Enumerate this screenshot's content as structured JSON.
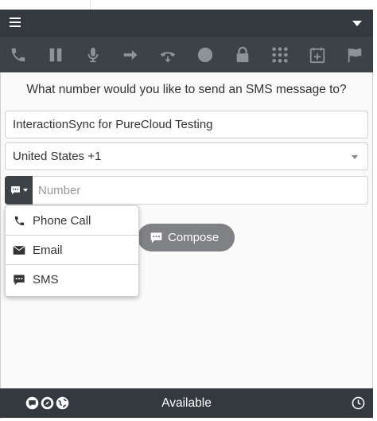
{
  "header": {
    "menu_icon": "hamburger-icon",
    "dropdown_icon": "caret-down-icon"
  },
  "toolbar": {
    "icons": [
      "phone-icon",
      "pause-icon",
      "microphone-icon",
      "transfer-arrow-icon",
      "hangup-icon",
      "record-icon",
      "lock-icon",
      "dialpad-icon",
      "calendar-add-icon",
      "flag-icon"
    ]
  },
  "prompt": "What number would you like to send an SMS message to?",
  "form": {
    "name_value": "InteractionSync for PureCloud Testing",
    "country_value": "United States +1",
    "number_placeholder": "Number"
  },
  "compose_label": "Compose",
  "menu": {
    "items": [
      {
        "label": "Phone Call",
        "icon": "phone-icon"
      },
      {
        "label": "Email",
        "icon": "envelope-icon"
      },
      {
        "label": "SMS",
        "icon": "chat-bubble-icon"
      }
    ]
  },
  "footer": {
    "status": "Available",
    "icons": [
      "chat-icon",
      "compass-icon",
      "globe-icon",
      "clock-icon"
    ]
  },
  "colors": {
    "header_bg": "#34393f",
    "toolbar_bg": "#3d4247",
    "compose_bg": "#7f8184"
  }
}
